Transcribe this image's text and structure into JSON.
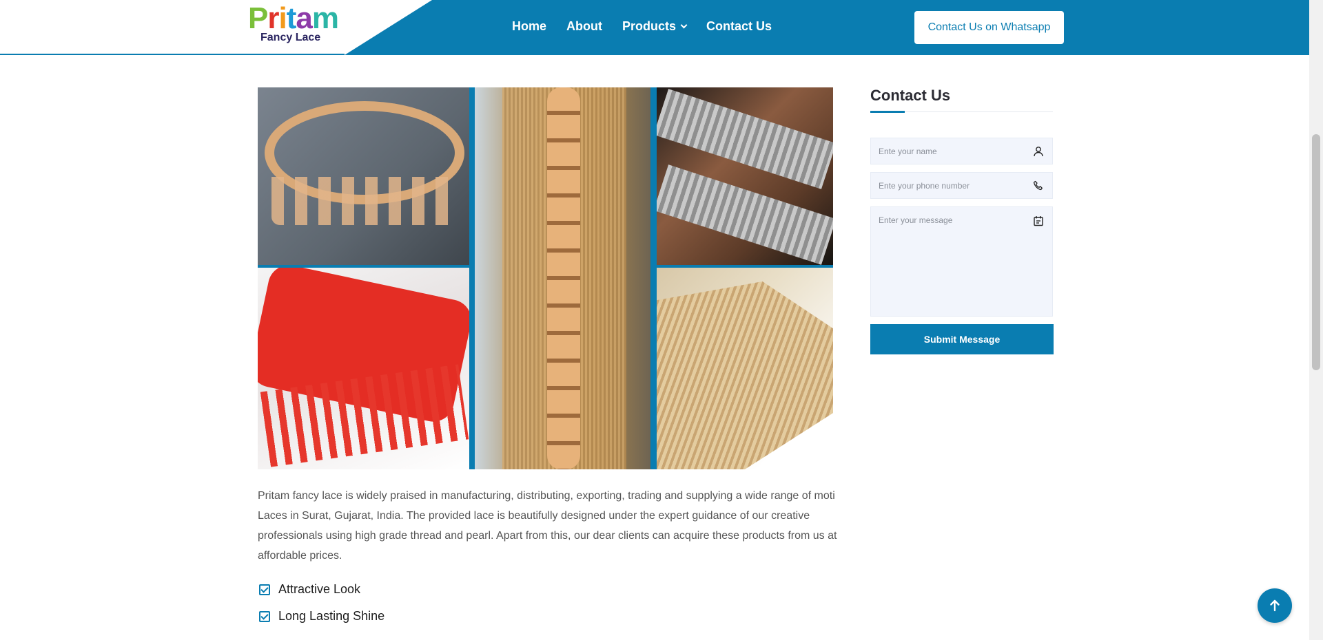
{
  "brand": {
    "logo_letters": [
      "P",
      "r",
      "i",
      "t",
      "a",
      "m"
    ],
    "logo_sub": "Fancy Lace"
  },
  "nav": {
    "items": [
      {
        "label": "Home"
      },
      {
        "label": "About"
      },
      {
        "label": "Products"
      },
      {
        "label": "Contact Us"
      }
    ],
    "whatsapp_label": "Contact Us on Whatsapp"
  },
  "gallery": {
    "images": [
      "gold-loop-lace",
      "gold-sequin-fringe-lace",
      "silver-tassel-lace",
      "red-fringe-lace",
      "gold-fringe-lace"
    ]
  },
  "content": {
    "description": "Pritam fancy lace is widely praised in manufacturing, distributing, exporting, trading and supplying a wide range of moti Laces in Surat, Gujarat, India. The provided lace is beautifully designed under the expert guidance of our creative professionals using high grade thread and pearl. Apart from this, our dear clients can acquire these products from us at affordable prices.",
    "features": [
      "Attractive Look",
      "Long Lasting Shine"
    ]
  },
  "contact_form": {
    "title": "Contact Us",
    "name_placeholder": "Ente your name",
    "phone_placeholder": "Ente your phone number",
    "message_placeholder": "Enter your message",
    "submit_label": "Submit Message"
  },
  "colors": {
    "primary": "#0a7db1",
    "field_bg": "#f2f5fc"
  }
}
